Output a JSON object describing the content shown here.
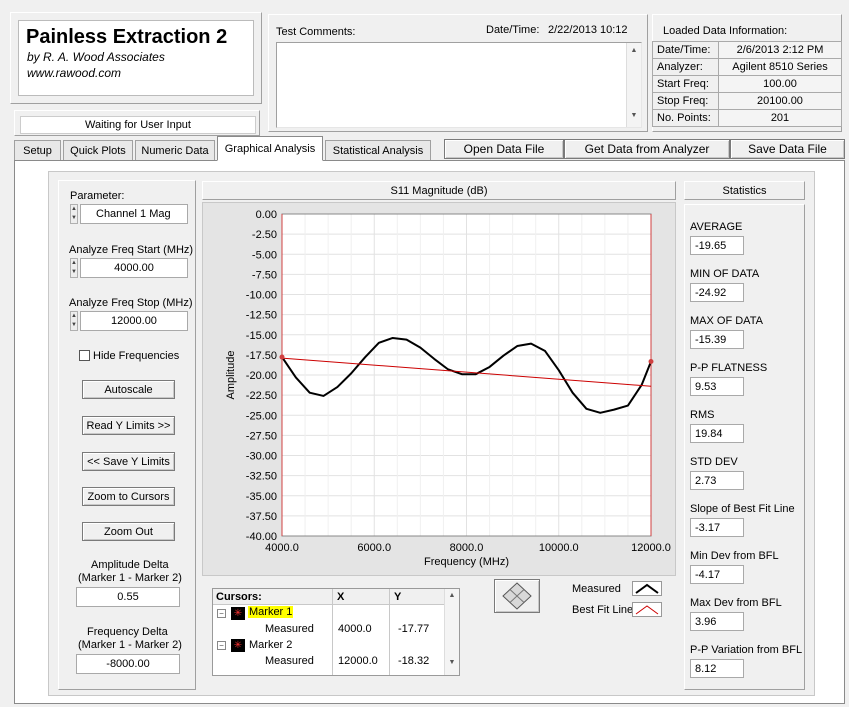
{
  "app": {
    "title": "Painless Extraction 2",
    "author": "by R. A. Wood Associates",
    "url": "www.rawood.com"
  },
  "status": "Waiting for User Input",
  "comments": {
    "label": "Test Comments:",
    "value": ""
  },
  "datetime": {
    "label": "Date/Time:",
    "value": "2/22/2013  10:12"
  },
  "loaded": {
    "title": "Loaded Data Information:",
    "rows": [
      {
        "label": "Date/Time:",
        "value": "2/6/2013 2:12 PM"
      },
      {
        "label": "Analyzer:",
        "value": "Agilent 8510 Series"
      },
      {
        "label": "Start Freq:",
        "value": "100.00"
      },
      {
        "label": "Stop Freq:",
        "value": "20100.00"
      },
      {
        "label": "No. Points:",
        "value": "201"
      }
    ]
  },
  "tabs": [
    "Setup",
    "Quick Plots",
    "Numeric Data",
    "Graphical Analysis",
    "Statistical Analysis"
  ],
  "toolbar": {
    "open": "Open Data File",
    "get": "Get Data from Analyzer",
    "save": "Save Data File"
  },
  "left": {
    "parameter_label": "Parameter:",
    "parameter_value": "Channel 1 Mag",
    "start_label": "Analyze Freq Start (MHz)",
    "start_value": "4000.00",
    "stop_label": "Analyze Freq Stop (MHz)",
    "stop_value": "12000.00",
    "hide_label": "Hide Frequencies",
    "autoscale": "Autoscale",
    "read_y": "Read Y Limits >>",
    "save_y": "<< Save Y Limits",
    "zoom_cursors": "Zoom to Cursors",
    "zoom_out": "Zoom Out",
    "amp_delta_label1": "Amplitude Delta",
    "amp_delta_label2": "(Marker 1 - Marker 2)",
    "amp_delta_value": "0.55",
    "freq_delta_label1": "Frequency Delta",
    "freq_delta_label2": "(Marker 1 - Marker 2)",
    "freq_delta_value": "-8000.00"
  },
  "chart_data": {
    "type": "line",
    "title": "S11 Magnitude (dB)",
    "xlabel": "Frequency (MHz)",
    "ylabel": "Amplitude",
    "xlim": [
      4000,
      12000
    ],
    "ylim": [
      -40,
      0
    ],
    "x_ticks": [
      "4000.0",
      "6000.0",
      "8000.0",
      "10000.0",
      "12000.0"
    ],
    "y_ticks": [
      "0.00",
      "-2.50",
      "-5.00",
      "-7.50",
      "-10.00",
      "-12.50",
      "-15.00",
      "-17.50",
      "-20.00",
      "-22.50",
      "-25.00",
      "-27.50",
      "-30.00",
      "-32.50",
      "-35.00",
      "-37.50",
      "-40.00"
    ],
    "grid": true,
    "series": [
      {
        "name": "Measured",
        "color": "#000000",
        "x": [
          4000,
          4300,
          4600,
          4900,
          5200,
          5500,
          5800,
          6100,
          6400,
          6700,
          7000,
          7300,
          7600,
          7900,
          8200,
          8500,
          8800,
          9100,
          9400,
          9700,
          10000,
          10300,
          10600,
          10900,
          11200,
          11500,
          11800,
          12000
        ],
        "y": [
          -17.77,
          -20.3,
          -22.2,
          -22.6,
          -21.5,
          -19.8,
          -17.8,
          -16.0,
          -15.4,
          -15.6,
          -16.6,
          -18.0,
          -19.3,
          -19.9,
          -19.9,
          -19.0,
          -17.6,
          -16.4,
          -16.1,
          -17.0,
          -19.4,
          -22.2,
          -24.2,
          -24.7,
          -24.3,
          -23.8,
          -21.2,
          -18.32
        ]
      },
      {
        "name": "Best Fit Line",
        "color": "#cc0000",
        "x": [
          4000,
          12000
        ],
        "y": [
          -17.9,
          -21.4
        ]
      }
    ],
    "cursors": [
      {
        "name": "Marker 1",
        "x": 4000.0,
        "y": -17.77
      },
      {
        "name": "Marker 2",
        "x": 12000.0,
        "y": -18.32
      }
    ]
  },
  "cursor_table": {
    "header": [
      "Cursors:",
      "X",
      "Y"
    ],
    "rows": [
      {
        "name": "Marker 1",
        "sub": "Measured",
        "x": "4000.0",
        "y": "-17.77"
      },
      {
        "name": "Marker 2",
        "sub": "Measured",
        "x": "12000.0",
        "y": "-18.32"
      }
    ]
  },
  "legend": [
    {
      "label": "Measured"
    },
    {
      "label": "Best Fit Line"
    }
  ],
  "stats": {
    "title": "Statistics",
    "items": [
      {
        "label": "AVERAGE",
        "value": "-19.65"
      },
      {
        "label": "MIN OF DATA",
        "value": "-24.92"
      },
      {
        "label": "MAX OF DATA",
        "value": "-15.39"
      },
      {
        "label": "P-P FLATNESS",
        "value": "9.53"
      },
      {
        "label": "RMS",
        "value": "19.84"
      },
      {
        "label": "STD DEV",
        "value": "2.73"
      },
      {
        "label": "Slope of Best Fit Line",
        "value": "-3.17"
      },
      {
        "label": "Min Dev from BFL",
        "value": "-4.17"
      },
      {
        "label": "Max Dev from BFL",
        "value": "3.96"
      },
      {
        "label": "P-P Variation from BFL",
        "value": "8.12"
      }
    ]
  }
}
